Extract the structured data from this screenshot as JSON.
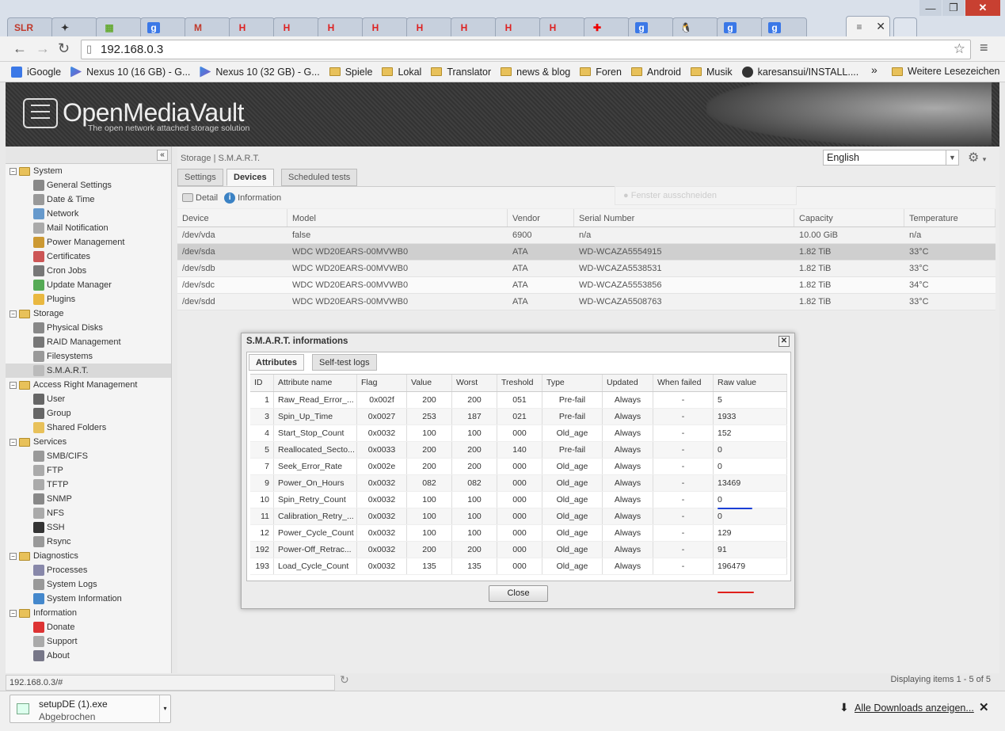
{
  "browser": {
    "tabs": [
      {
        "icon": "slr-icon",
        "glyph": "SLR",
        "color": "#c0392b"
      },
      {
        "icon": "gamepad-icon",
        "glyph": "✦",
        "color": "#333"
      },
      {
        "icon": "shop-icon",
        "glyph": "▦",
        "color": "#6a3"
      },
      {
        "icon": "google-icon",
        "glyph": "g",
        "color": "#fff"
      },
      {
        "icon": "gmail-icon",
        "glyph": "M",
        "color": "#c0392b"
      },
      {
        "icon": "h-icon",
        "glyph": "H",
        "color": "#d22"
      },
      {
        "icon": "h-icon",
        "glyph": "H",
        "color": "#d22"
      },
      {
        "icon": "h-icon",
        "glyph": "H",
        "color": "#d22"
      },
      {
        "icon": "h-icon",
        "glyph": "H",
        "color": "#d22"
      },
      {
        "icon": "h-icon",
        "glyph": "H",
        "color": "#d22"
      },
      {
        "icon": "h-icon",
        "glyph": "H",
        "color": "#d22"
      },
      {
        "icon": "h-icon",
        "glyph": "H",
        "color": "#d22"
      },
      {
        "icon": "h-icon",
        "glyph": "H",
        "color": "#d22"
      },
      {
        "icon": "red-cross-icon",
        "glyph": "✚",
        "color": "#e00"
      },
      {
        "icon": "google-icon",
        "glyph": "g",
        "color": "#fff"
      },
      {
        "icon": "tux-icon",
        "glyph": "🐧",
        "color": "#000"
      },
      {
        "icon": "google-icon",
        "glyph": "g",
        "color": "#fff"
      },
      {
        "icon": "google-icon",
        "glyph": "g",
        "color": "#fff"
      },
      {
        "icon": "page-icon",
        "glyph": "≡",
        "color": "#555",
        "active": true
      }
    ],
    "url": "192.168.0.3",
    "bookmarks": [
      {
        "label": "iGoogle",
        "kind": "google"
      },
      {
        "label": "Nexus 10 (16 GB) - G...",
        "kind": "play"
      },
      {
        "label": "Nexus 10 (32 GB) - G...",
        "kind": "play"
      },
      {
        "label": "Spiele",
        "kind": "folder"
      },
      {
        "label": "Lokal",
        "kind": "folder"
      },
      {
        "label": "Translator",
        "kind": "folder"
      },
      {
        "label": "news & blog",
        "kind": "folder"
      },
      {
        "label": "Foren",
        "kind": "folder"
      },
      {
        "label": "Android",
        "kind": "folder"
      },
      {
        "label": "Musik",
        "kind": "folder"
      },
      {
        "label": "karesansui/INSTALL....",
        "kind": "github"
      }
    ],
    "more_bookmarks": "»",
    "other_bookmarks": "Weitere Lesezeichen",
    "status_url": "192.168.0.3/#",
    "download": {
      "file": "setupDE (1).exe",
      "state": "Abgebrochen"
    },
    "show_all_downloads": "Alle Downloads anzeigen..."
  },
  "app": {
    "title": "OpenMediaVault",
    "subtitle": "The open network attached storage solution",
    "language": "English",
    "breadcrumb": "Storage | S.M.A.R.T.",
    "tabs": [
      "Settings",
      "Devices",
      "Scheduled tests"
    ],
    "active_tab": 1,
    "sub_buttons": [
      "Detail",
      "Information"
    ],
    "ghost_text": "Fenster ausschneiden",
    "paging": "Displaying items 1 - 5 of 5"
  },
  "nav": [
    {
      "label": "System",
      "group": true
    },
    {
      "label": "General Settings",
      "icon": "tools-icon",
      "color": "#888"
    },
    {
      "label": "Date & Time",
      "icon": "clock-icon",
      "color": "#999"
    },
    {
      "label": "Network",
      "icon": "network-icon",
      "color": "#69c"
    },
    {
      "label": "Mail Notification",
      "icon": "mail-icon",
      "color": "#aaa"
    },
    {
      "label": "Power Management",
      "icon": "power-icon",
      "color": "#c93"
    },
    {
      "label": "Certificates",
      "icon": "certificate-icon",
      "color": "#c55"
    },
    {
      "label": "Cron Jobs",
      "icon": "cron-icon",
      "color": "#777"
    },
    {
      "label": "Update Manager",
      "icon": "update-icon",
      "color": "#5a5"
    },
    {
      "label": "Plugins",
      "icon": "plugin-icon",
      "color": "#e9b840"
    },
    {
      "label": "Storage",
      "group": true
    },
    {
      "label": "Physical Disks",
      "icon": "disk-icon",
      "color": "#888"
    },
    {
      "label": "RAID Management",
      "icon": "raid-icon",
      "color": "#777"
    },
    {
      "label": "Filesystems",
      "icon": "filesystem-icon",
      "color": "#999"
    },
    {
      "label": "S.M.A.R.T.",
      "icon": "smart-icon",
      "color": "#bbb",
      "selected": true
    },
    {
      "label": "Access Right Management",
      "group": true
    },
    {
      "label": "User",
      "icon": "user-icon",
      "color": "#666"
    },
    {
      "label": "Group",
      "icon": "group-icon",
      "color": "#666"
    },
    {
      "label": "Shared Folders",
      "icon": "shared-folder-icon",
      "color": "#e8c15a"
    },
    {
      "label": "Services",
      "group": true
    },
    {
      "label": "SMB/CIFS",
      "icon": "smb-icon",
      "color": "#999"
    },
    {
      "label": "FTP",
      "icon": "ftp-icon",
      "color": "#aaa"
    },
    {
      "label": "TFTP",
      "icon": "tftp-icon",
      "color": "#aaa"
    },
    {
      "label": "SNMP",
      "icon": "snmp-icon",
      "color": "#888"
    },
    {
      "label": "NFS",
      "icon": "nfs-icon",
      "color": "#aaa"
    },
    {
      "label": "SSH",
      "icon": "ssh-icon",
      "color": "#333"
    },
    {
      "label": "Rsync",
      "icon": "rsync-icon",
      "color": "#999"
    },
    {
      "label": "Diagnostics",
      "group": true
    },
    {
      "label": "Processes",
      "icon": "processes-icon",
      "color": "#88a"
    },
    {
      "label": "System Logs",
      "icon": "logs-icon",
      "color": "#999"
    },
    {
      "label": "System Information",
      "icon": "info-icon",
      "color": "#48c"
    },
    {
      "label": "Information",
      "group": true
    },
    {
      "label": "Donate",
      "icon": "heart-icon",
      "color": "#d33"
    },
    {
      "label": "Support",
      "icon": "support-icon",
      "color": "#aaa"
    },
    {
      "label": "About",
      "icon": "about-icon",
      "color": "#778"
    }
  ],
  "devices": {
    "columns": [
      "Device",
      "Model",
      "Vendor",
      "Serial Number",
      "Capacity",
      "Temperature"
    ],
    "rows": [
      [
        "/dev/vda",
        "false",
        "6900",
        "n/a",
        "10.00 GiB",
        "n/a"
      ],
      [
        "/dev/sda",
        "WDC WD20EARS-00MVWB0",
        "ATA",
        "WD-WCAZA5554915",
        "1.82 TiB",
        "33°C"
      ],
      [
        "/dev/sdb",
        "WDC WD20EARS-00MVWB0",
        "ATA",
        "WD-WCAZA5538531",
        "1.82 TiB",
        "33°C"
      ],
      [
        "/dev/sdc",
        "WDC WD20EARS-00MVWB0",
        "ATA",
        "WD-WCAZA5553856",
        "1.82 TiB",
        "34°C"
      ],
      [
        "/dev/sdd",
        "WDC WD20EARS-00MVWB0",
        "ATA",
        "WD-WCAZA5508763",
        "1.82 TiB",
        "33°C"
      ]
    ],
    "selected_row": 1
  },
  "smart": {
    "title": "S.M.A.R.T. informations",
    "tabs": [
      "Attributes",
      "Self-test logs"
    ],
    "columns": [
      "ID",
      "Attribute name",
      "Flag",
      "Value",
      "Worst",
      "Treshold",
      "Type",
      "Updated",
      "When failed",
      "Raw value"
    ],
    "rows": [
      [
        "1",
        "Raw_Read_Error_...",
        "0x002f",
        "200",
        "200",
        "051",
        "Pre-fail",
        "Always",
        "-",
        "5"
      ],
      [
        "3",
        "Spin_Up_Time",
        "0x0027",
        "253",
        "187",
        "021",
        "Pre-fail",
        "Always",
        "-",
        "1933"
      ],
      [
        "4",
        "Start_Stop_Count",
        "0x0032",
        "100",
        "100",
        "000",
        "Old_age",
        "Always",
        "-",
        "152"
      ],
      [
        "5",
        "Reallocated_Secto...",
        "0x0033",
        "200",
        "200",
        "140",
        "Pre-fail",
        "Always",
        "-",
        "0"
      ],
      [
        "7",
        "Seek_Error_Rate",
        "0x002e",
        "200",
        "200",
        "000",
        "Old_age",
        "Always",
        "-",
        "0"
      ],
      [
        "9",
        "Power_On_Hours",
        "0x0032",
        "082",
        "082",
        "000",
        "Old_age",
        "Always",
        "-",
        "13469"
      ],
      [
        "10",
        "Spin_Retry_Count",
        "0x0032",
        "100",
        "100",
        "000",
        "Old_age",
        "Always",
        "-",
        "0"
      ],
      [
        "11",
        "Calibration_Retry_...",
        "0x0032",
        "100",
        "100",
        "000",
        "Old_age",
        "Always",
        "-",
        "0"
      ],
      [
        "12",
        "Power_Cycle_Count",
        "0x0032",
        "100",
        "100",
        "000",
        "Old_age",
        "Always",
        "-",
        "129"
      ],
      [
        "192",
        "Power-Off_Retrac...",
        "0x0032",
        "200",
        "200",
        "000",
        "Old_age",
        "Always",
        "-",
        "91"
      ],
      [
        "193",
        "Load_Cycle_Count",
        "0x0032",
        "135",
        "135",
        "000",
        "Old_age",
        "Always",
        "-",
        "196479"
      ]
    ],
    "annotations": {
      "blue": "#1b3fd6",
      "red": "#e0201b"
    },
    "close_label": "Close"
  }
}
